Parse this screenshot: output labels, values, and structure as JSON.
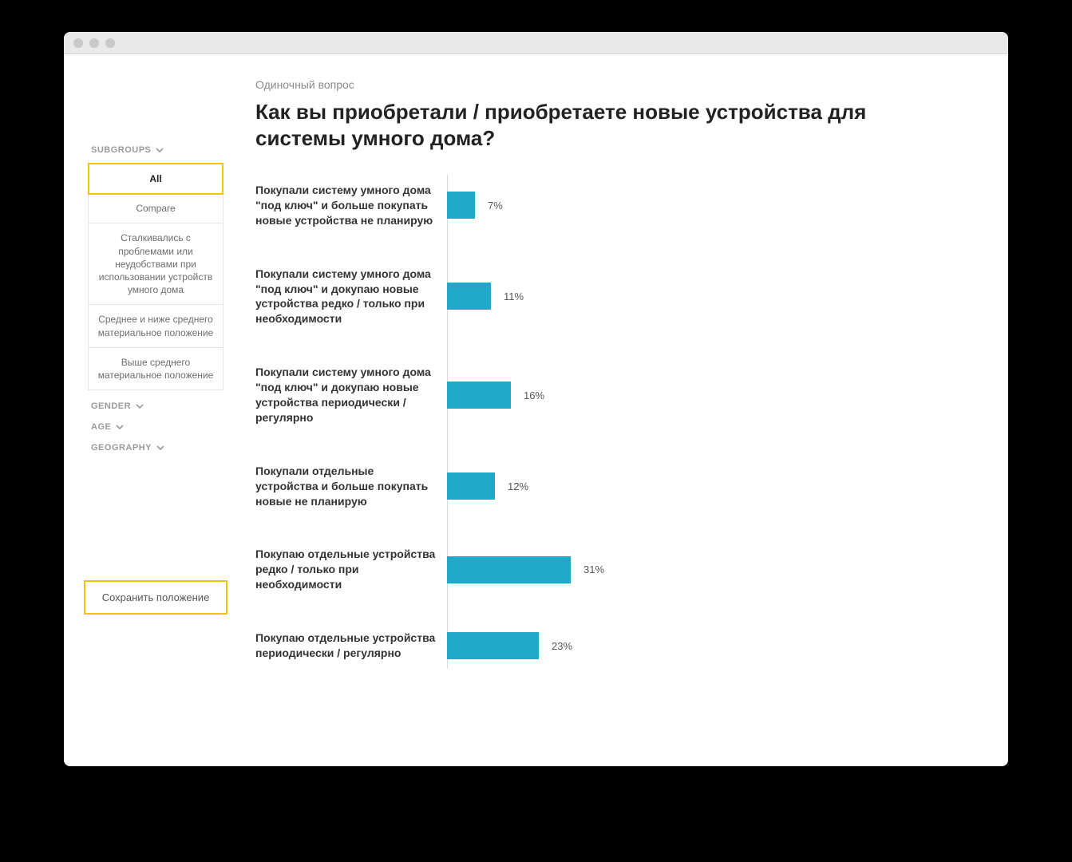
{
  "header": {
    "eyebrow": "Одиночный вопрос",
    "title": "Как вы приобретали / приобретаете новые устройства для системы умного дома?"
  },
  "sidebar": {
    "subgroups_label": "SUBGROUPS",
    "items": [
      "All",
      "Compare",
      "Сталкивались с проблемами или неудобствами при использовании устройств умного дома",
      "Среднее и ниже среднего материальное положение",
      "Выше среднего материальное положение"
    ],
    "gender_label": "GENDER",
    "age_label": "AGE",
    "geography_label": "GEOGRAPHY",
    "save_label": "Сохранить положение"
  },
  "chart_data": {
    "type": "bar",
    "orientation": "horizontal",
    "xlim": [
      0,
      100
    ],
    "unit": "%",
    "categories": [
      "Покупали систему умного дома \"под ключ\" и больше покупать новые устройства не планирую",
      "Покупали систему умного дома \"под ключ\" и докупаю новые устройства редко / только при необходимости",
      "Покупали систему умного дома \"под ключ\" и докупаю новые устройства периодически / регулярно",
      "Покупали отдельные устройства и больше покупать новые не планирую",
      "Покупаю отдельные устройства редко / только при необходимости",
      "Покупаю отдельные устройства периодически / регулярно"
    ],
    "values": [
      7,
      11,
      16,
      12,
      31,
      23
    ],
    "display_values": [
      "7%",
      "11%",
      "16%",
      "12%",
      "31%",
      "23%"
    ],
    "bar_color": "#1fa8c9"
  }
}
